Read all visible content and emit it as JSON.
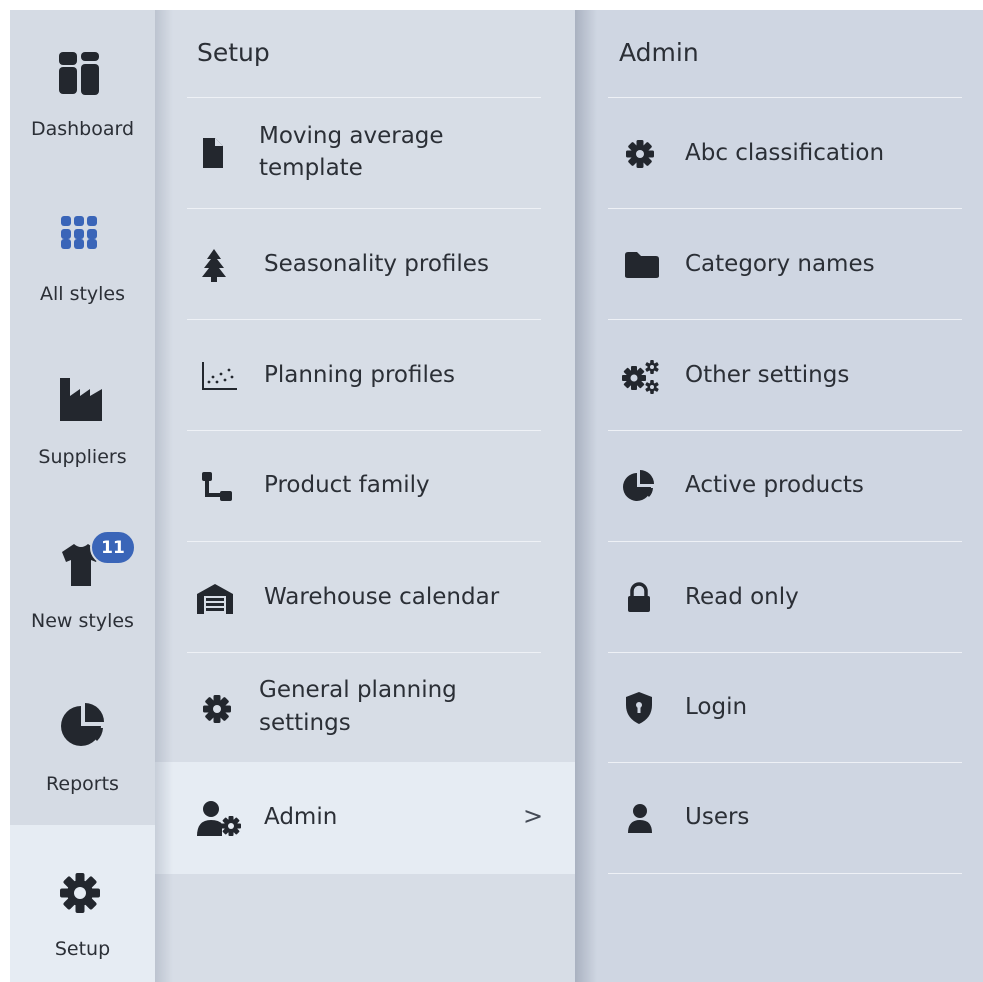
{
  "rail": {
    "items": [
      {
        "label": "Dashboard",
        "icon": "dashboard-icon"
      },
      {
        "label": "All styles",
        "icon": "grid-icon"
      },
      {
        "label": "Suppliers",
        "icon": "factory-icon"
      },
      {
        "label": "New styles",
        "icon": "tshirt-icon",
        "badge": "11"
      },
      {
        "label": "Reports",
        "icon": "pie-chart-icon"
      },
      {
        "label": "Setup",
        "icon": "gear-icon",
        "active": true
      }
    ]
  },
  "setup": {
    "title": "Setup",
    "items": [
      {
        "label": "Moving average template",
        "line1": "Moving average",
        "line2": "template",
        "icon": "file-icon"
      },
      {
        "label": "Seasonality profiles",
        "icon": "tree-icon"
      },
      {
        "label": "Planning profiles",
        "icon": "scatter-chart-icon"
      },
      {
        "label": "Product family",
        "icon": "connection-icon"
      },
      {
        "label": "Warehouse calendar",
        "icon": "warehouse-icon"
      },
      {
        "label": "General planning settings",
        "line1": "General planning",
        "line2": "settings",
        "icon": "gear-icon"
      },
      {
        "label": "Admin",
        "icon": "user-gear-icon",
        "active": true,
        "chevron": ">"
      }
    ]
  },
  "admin": {
    "title": "Admin",
    "items": [
      {
        "label": "Abc classification",
        "icon": "gear-icon"
      },
      {
        "label": "Category names",
        "icon": "folder-icon"
      },
      {
        "label": "Other settings",
        "icon": "gears-icon"
      },
      {
        "label": "Active products",
        "icon": "pie-chart-icon"
      },
      {
        "label": "Read only",
        "icon": "lock-icon"
      },
      {
        "label": "Login",
        "icon": "shield-icon"
      },
      {
        "label": "Users",
        "icon": "user-icon"
      }
    ]
  },
  "colors": {
    "rail_bg": "#d5dbe4",
    "active_bg": "#e6ecf3",
    "setup_bg": "#d7dde6",
    "admin_bg": "#cfd6e2",
    "badge": "#3a65b8",
    "icon": "#23272e"
  }
}
